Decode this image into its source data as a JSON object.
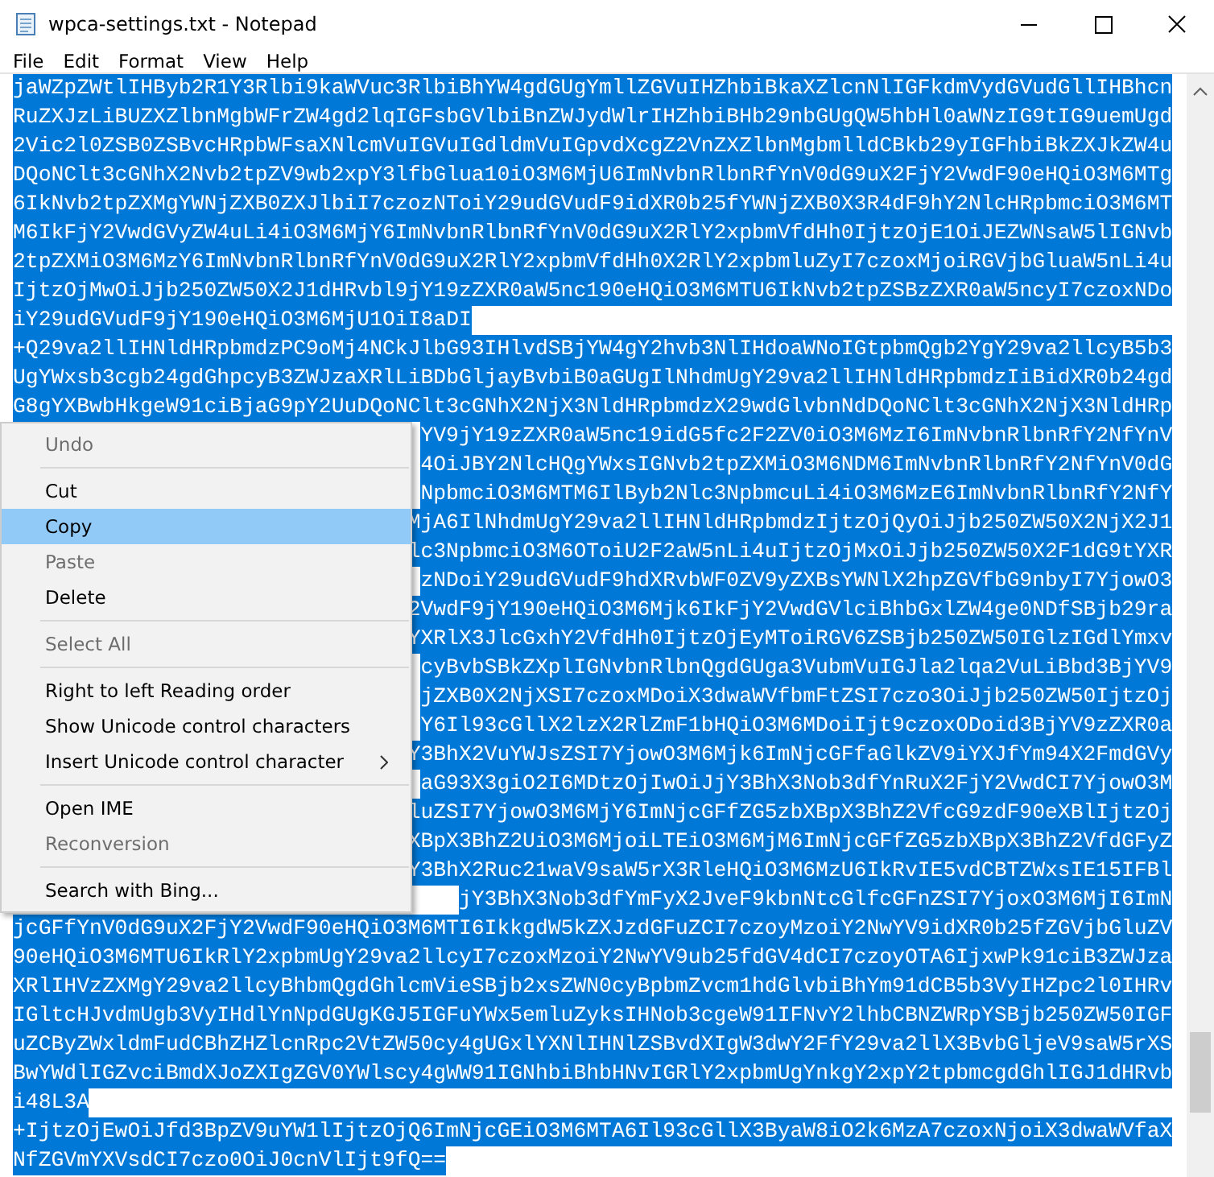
{
  "window": {
    "title": "wpca-settings.txt - Notepad"
  },
  "menu_bar": [
    "File",
    "Edit",
    "Format",
    "View",
    "Help"
  ],
  "editor": {
    "lines_above_menu": [
      "jaWZpZWtlIHByb2R1Y3Rlbi9kaWVuc3RlbiBhYW4gdGUgYmllZGVuIHZhbiBkaXZlcnNlIGFkdmVydGVudGllIHBhcn",
      "RuZXJzLiBUZXZlbnMgbWFrZW4gd2lqIGFsbGVlbiBnZWJydWlrIHZhbiBHb29nbGUgQW5hbHl0aWNzIG9tIG9uemUgd",
      "2Vic2l0ZSB0ZSBvcHRpbWFsaXNlcmVuIGVuIGdldmVuIGpvdXcgZ2VnZXZlbnMgbmlldCBkb29yIGFhbiBkZXJkZW4u",
      "DQoNClt3cGNhX2Nvb2tpZV9wb2xpY3lfbGlua10iO3M6MjU6ImNvbnRlbnRfYnV0dG9uX2FjY2VwdF90eHQiO3M6MTg",
      "6IkNvb2tpZXMgYWNjZXB0ZXJlbiI7czozNToiY29udGVudF9idXR0b25fYWNjZXB0X3R4dF9hY2NlcHRpbmciO3M6MT",
      "M6IkFjY2VwdGVyZW4uLi4iO3M6MjY6ImNvbnRlbnRfYnV0dG9uX2RlY2xpbmVfdHh0IjtzOjE1OiJEZWNsaW5lIGNvb",
      "2tpZXMiO3M6MzY6ImNvbnRlbnRfYnV0dG9uX2RlY2xpbmVfdHh0X2RlY2xpbmluZyI7czoxMjoiRGVjbGluaW5nLi4u",
      "IjtzOjMwOiJjb250ZW50X2J1dHRvbl9jY19zZXR0aW5nc190eHQiO3M6MTU6IkNvb2tpZSBzZXR0aW5ncyI7czoxNDo",
      "iY29udGVudF9jY190eHQiO3M6MjU1OiI8aDI",
      "+Q29va2llIHNldHRpbmdzPC9oMj4NCkJlbG93IHlvdSBjYW4gY2hvb3NlIHdoaWNoIGtpbmQgb2YgY29va2llcyB5b3",
      "UgYWxsb3cgb24gdGhpcyB3ZWJzaXRlLiBDbGljayBvbiB0aGUgIlNhdmUgY29va2llIHNldHRpbmdzIiBidXR0b24gd",
      "G8gYXBwbHkgeW91ciBjaG9pY2UuDQoNClt3cGNhX2NjX3NldHRpbmdzX29wdGlvbnNdDQoNClt3cGNhX2NjX3NldHRp"
    ],
    "lines_beside_menu": [
      "YV9jY19zZXR0aW5nc19idG5fc2F2ZV0iO3M6MzI6ImNvbnRlbnRfY2NfYnV",
      "4OiJBY2NlcHQgYWxsIGNvb2tpZXMiO3M6NDM6ImNvbnRlbnRfY2NfYnV0dG",
      "NpbmciO3M6MTM6IlByb2Nlc3NpbmcuLi4iO3M6MzE6ImNvbnRlbnRfY2NfY",
      "MjA6IlNhdmUgY29va2llIHNldHRpbmdzIjtzOjQyOiJjb250ZW50X2NjX2J1",
      "lc3NpbmciO3M6OToiU2F2aW5nLi4uIjtzOjMxOiJjb250ZW50X2F1dG9tYXR",
      "zNDoiY29udGVudF9hdXRvbWF0ZV9yZXBsYWNlX2hpZGVfbG9nbyI7YjowO3",
      "2VwdF9jY190eHQiO3M6Mjk6IkFjY2VwdGVlciBhbGxlZW4ge0NDfSBjb29ra",
      "YXRlX3JlcGxhY2VfdHh0IjtzOjEyMToiRGV6ZSBjb250ZW50IGlzIGdlYmxv",
      "cyBvbSBkZXplIGNvbnRlbnQgdGUga3VubmVuIGJla2lqa2VuLiBbd3BjYV9",
      "jZXB0X2NjXSI7czoxMDoiX3dwaWVfbmFtZSI7czo3OiJjb250ZW50IjtzOj",
      "Y6Il93cGllX2lzX2RlZmF1bHQiO3M6MDoiIjt9czoxODoid3BjYV9zZXR0a",
      "Y3BhX2VuYWJsZSI7YjowO3M6Mjk6ImNjcGFfaGlkZV9iYXJfYm94X2FmdGVy",
      "aG93X3giO2I6MDtzOjIwOiJjY3BhX3Nob3dfYnRuX2FjY2VwdCI7YjowO3M",
      "luZSI7YjowO3M6MjY6ImNjcGFfZG5zbXBpX3BhZ2VfcG9zdF90eXBlIjtzOj",
      "XBpX3BhZ2UiO3M6MjoiLTEiO3M6MjM6ImNjcGFfZG5zbXBpX3BhZ2VfdGFyZ",
      "Y3BhX2Ruc21waV9saW5rX3RleHQiO3M6MzU6IkRvIE5vdCBTZWxsIE15IFBl",
      "jY3BhX3Nob3dfYmFyX2JveF9kbnNtcGlfcGFnZSI7YjoxO3M6MjI6ImN"
    ],
    "lines_below_menu": [
      "jcGFfYnV0dG9uX2FjY2VwdF90eHQiO3M6MTI6IkkgdW5kZXJzdGFuZCI7czoyMzoiY2NwYV9idXR0b25fZGVjbGluZV",
      "90eHQiO3M6MTU6IkRlY2xpbmUgY29va2llcyI7czoxMzoiY2NwYV9ub25fdGV4dCI7czoyOTA6IjxwPk91ciB3ZWJza",
      "XRlIHVzZXMgY29va2llcyBhbmQgdGhlcmVieSBjb2xsZWN0cyBpbmZvcm1hdGlvbiBhYm91dCB5b3VyIHZpc2l0IHRv",
      "IGltcHJvdmUgb3VyIHdlYnNpdGUgKGJ5IGFuYWx5emluZyksIHNob3cgeW91IFNvY2lhbCBNZWRpYSBjb250ZW50IGF",
      "uZCByZWxldmFudCBhZHZlcnRpc2VtZW50cy4gUGxlYXNlIHNlZSBvdXIgW3dwY2FfY29va2llX3BvbGljeV9saW5rXS",
      "BwYWdlIGZvciBmdXJoZXIgZGV0YWlscy4gWW91IGNhbiBhbHNvIGRlY2xpbmUgYnkgY2xpY2tpbmcgdGhlIGJ1dHRvb",
      "i48L3A",
      "+IjtzOjEwOiJfd3BpZV9uYW1lIjtzOjQ6ImNjcGEiO3M6MTA6Il93cGllX3ByaW8iO2k6MzA7czoxNjoiX3dwaWVfaX",
      "NfZGVmYXVsdCI7czo0OiJ0cnVlIjt9fQ=="
    ]
  },
  "context_menu": {
    "items": [
      {
        "kind": "item",
        "label": "Undo",
        "disabled": true,
        "selected": false
      },
      {
        "kind": "separator"
      },
      {
        "kind": "item",
        "label": "Cut",
        "disabled": false,
        "selected": false
      },
      {
        "kind": "item",
        "label": "Copy",
        "disabled": false,
        "selected": true
      },
      {
        "kind": "item",
        "label": "Paste",
        "disabled": true,
        "selected": false
      },
      {
        "kind": "item",
        "label": "Delete",
        "disabled": false,
        "selected": false
      },
      {
        "kind": "separator"
      },
      {
        "kind": "item",
        "label": "Select All",
        "disabled": true,
        "selected": false
      },
      {
        "kind": "separator"
      },
      {
        "kind": "item",
        "label": "Right to left Reading order",
        "disabled": false,
        "selected": false
      },
      {
        "kind": "item",
        "label": "Show Unicode control characters",
        "disabled": false,
        "selected": false
      },
      {
        "kind": "item",
        "label": "Insert Unicode control character",
        "disabled": false,
        "selected": false,
        "submenu": true
      },
      {
        "kind": "separator"
      },
      {
        "kind": "item",
        "label": "Open IME",
        "disabled": false,
        "selected": false
      },
      {
        "kind": "item",
        "label": "Reconversion",
        "disabled": true,
        "selected": false
      },
      {
        "kind": "separator"
      },
      {
        "kind": "item",
        "label": "Search with Bing...",
        "disabled": false,
        "selected": false
      }
    ]
  }
}
